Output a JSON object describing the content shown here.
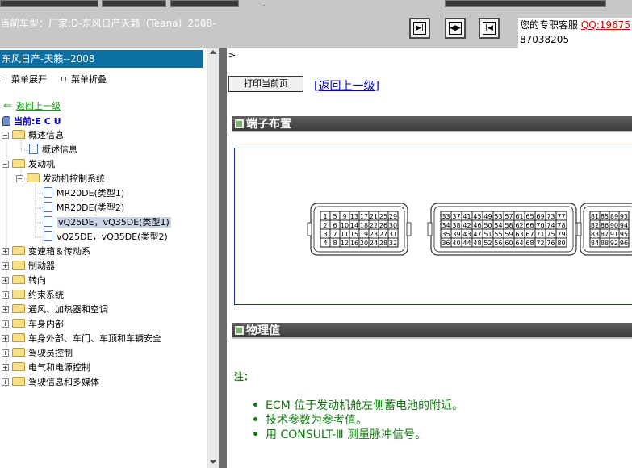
{
  "header": {
    "car_title": "当前车型：厂家:D-东风日产天籁（Teana）2008-",
    "service_label": "您的专职客服",
    "qq": "QQ:19675",
    "phone": "87038205",
    "tab_marker": "."
  },
  "nav_buttons": {
    "first_icon": "first-page-icon",
    "both_icon": "expand-both-icon",
    "last_icon": "last-page-icon"
  },
  "left": {
    "panel_title": "东风日产-天籁--2008",
    "expand_label": "菜单展开",
    "collapse_label": "菜单折叠",
    "back_label": "返回上一级",
    "current_label": "当前:E C U",
    "tree": {
      "overview": "概述信息",
      "overview_child": "概述信息",
      "engine": "发动机",
      "engine_control": "发动机控制系统",
      "mr20de_1": "MR20DE(类型1)",
      "mr20de_2": "MR20DE(类型2)",
      "vq_1": "vQ25DE，vQ35DE(类型1)",
      "vq_2": "vQ25DE，vQ35DE(类型2)",
      "transmission": "变速箱＆传动系",
      "brake": "制动器",
      "steering": "转向",
      "restraint": "约束系统",
      "hvac": "通风、加热器和空调",
      "interior": "车身内部",
      "exterior": "车身外部、车门、车顶和车辆安全",
      "driver_control": "驾驶员控制",
      "electrical": "电气和电源控制",
      "infotainment": "驾驶信息和多媒体"
    }
  },
  "right": {
    "gt_symbol": ">",
    "print_label": "打印当前页",
    "back_upper_label": "[返回上一级]",
    "section1_title": "端子布置",
    "section2_title": "物理值",
    "note_label": "注：",
    "notes": [
      "ECM 位于发动机舱左侧蓄电池的附近。",
      "技术参数为参考值。",
      "用  CONSULT-Ⅲ 测量脉冲信号。"
    ],
    "connector1": {
      "rows": [
        [
          "1",
          "5",
          "9",
          "13",
          "17",
          "21",
          "25",
          "29"
        ],
        [
          "2",
          "6",
          "10",
          "14",
          "18",
          "22",
          "26",
          "30"
        ],
        [
          "3",
          "7",
          "11",
          "15",
          "19",
          "23",
          "27",
          "31"
        ],
        [
          "4",
          "8",
          "12",
          "16",
          "20",
          "24",
          "28",
          "32"
        ]
      ]
    },
    "connector2": {
      "rows": [
        [
          "33",
          "37",
          "41",
          "45",
          "49",
          "53",
          "57",
          "61",
          "65",
          "69",
          "73",
          "77"
        ],
        [
          "34",
          "38",
          "42",
          "46",
          "50",
          "54",
          "58",
          "62",
          "66",
          "70",
          "74",
          "78"
        ],
        [
          "35",
          "39",
          "43",
          "47",
          "51",
          "55",
          "59",
          "63",
          "67",
          "71",
          "75",
          "79"
        ],
        [
          "36",
          "40",
          "44",
          "48",
          "52",
          "56",
          "60",
          "64",
          "68",
          "72",
          "76",
          "80"
        ]
      ]
    },
    "connector3": {
      "rows": [
        [
          "81",
          "85",
          "89",
          "93"
        ],
        [
          "82",
          "86",
          "90",
          "94"
        ],
        [
          "83",
          "87",
          "91",
          "95"
        ],
        [
          "84",
          "88",
          "92",
          "96"
        ]
      ]
    }
  },
  "colors": {
    "panel_title_bg": "#0b6fa3",
    "section_bar": "#4a4a4a",
    "note_green": "#117a11",
    "link_blue": "#0000cc",
    "qq_red": "#e00000"
  }
}
